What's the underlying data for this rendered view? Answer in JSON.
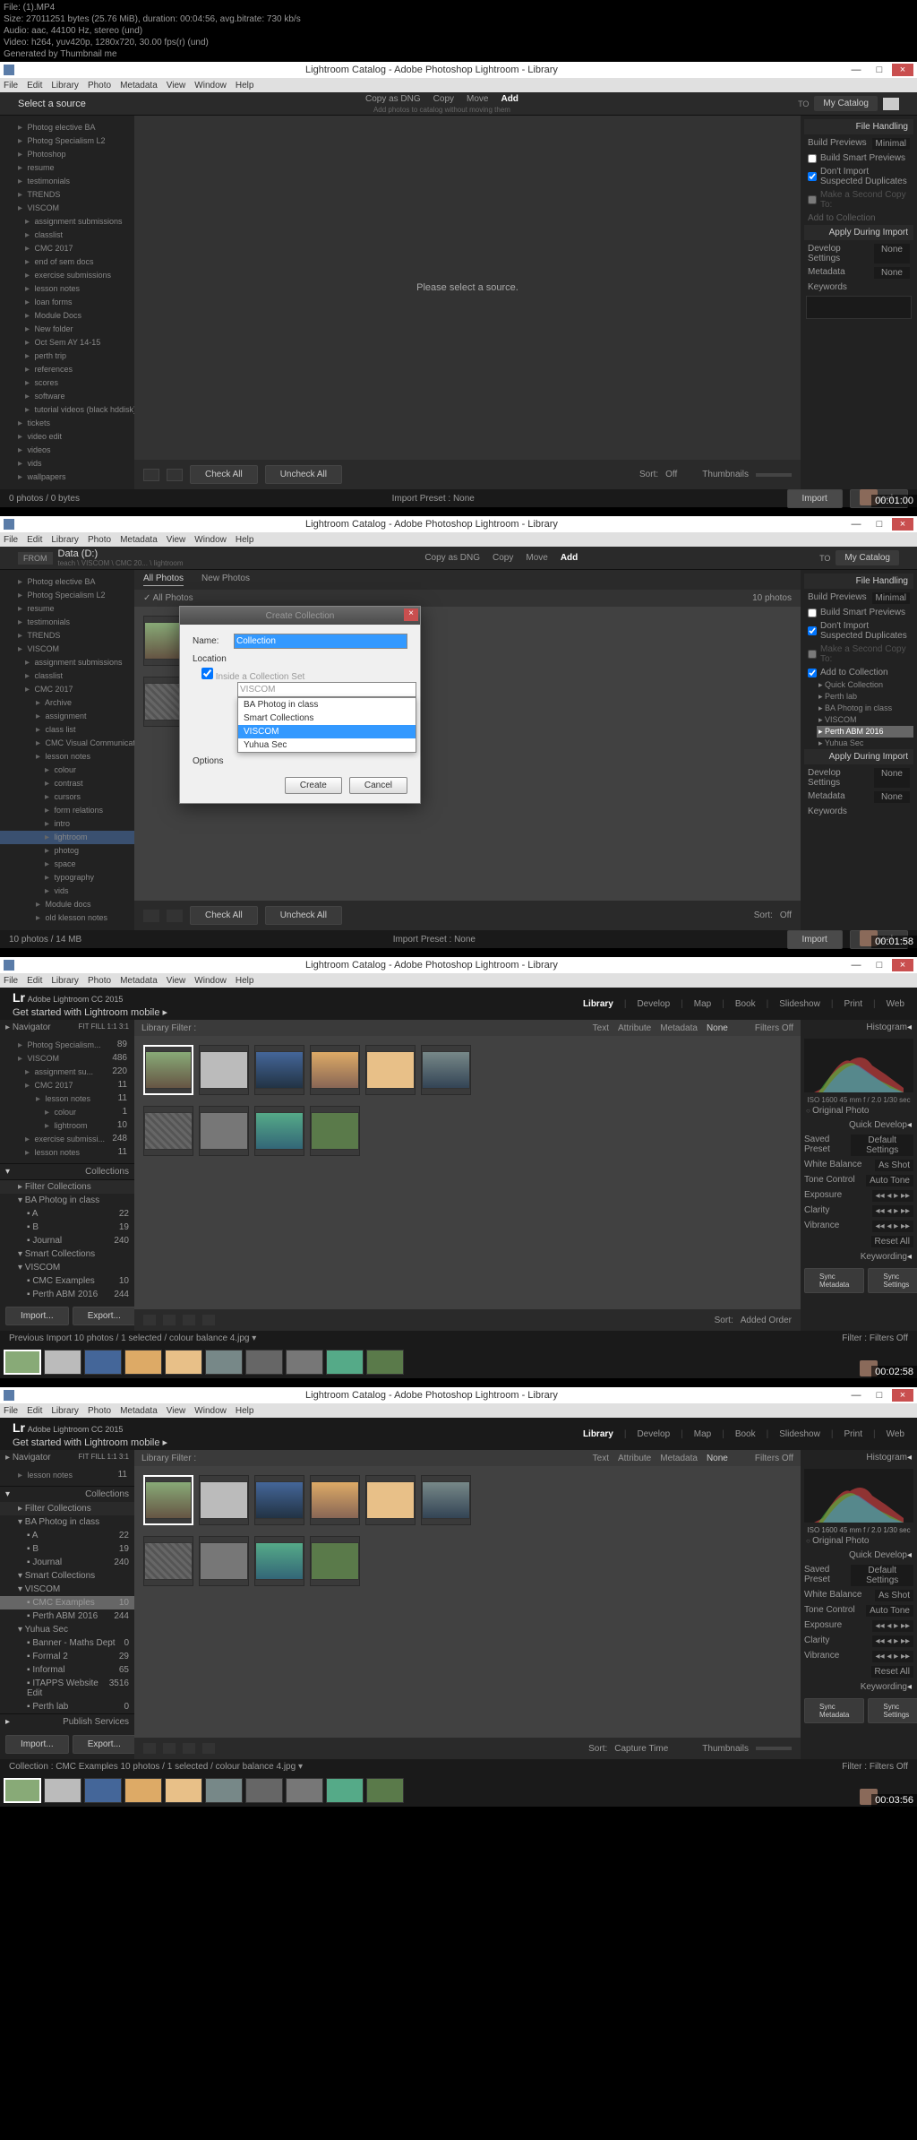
{
  "file_info": {
    "line1": "File:  (1).MP4",
    "line2": "Size: 27011251 bytes (25.76 MiB), duration: 00:04:56, avg.bitrate: 730 kb/s",
    "line3": "Audio: aac, 44100 Hz, stereo (und)",
    "line4": "Video: h264, yuv420p, 1280x720, 30.00 fps(r) (und)",
    "line5": "Generated by Thumbnail me"
  },
  "window_title": "Lightroom Catalog - Adobe Photoshop Lightroom - Library",
  "menu": [
    "File",
    "Edit",
    "Library",
    "Photo",
    "Metadata",
    "View",
    "Window",
    "Help"
  ],
  "s1": {
    "source_label": "Select a source",
    "actions": [
      "Copy as DNG",
      "Copy",
      "Move",
      "Add"
    ],
    "action_sub": "Add photos to catalog without moving them",
    "catalog": "My Catalog",
    "to": "TO",
    "center_msg": "Please select a source.",
    "tree": [
      {
        "l": 0,
        "t": "Photog elective BA"
      },
      {
        "l": 0,
        "t": "Photog Specialism L2"
      },
      {
        "l": 0,
        "t": "Photoshop"
      },
      {
        "l": 0,
        "t": "resume"
      },
      {
        "l": 0,
        "t": "testimonials"
      },
      {
        "l": 0,
        "t": "TRENDS"
      },
      {
        "l": 0,
        "t": "VISCOM"
      },
      {
        "l": 1,
        "t": "assignment submissions"
      },
      {
        "l": 1,
        "t": "classlist"
      },
      {
        "l": 1,
        "t": "CMC 2017"
      },
      {
        "l": 1,
        "t": "end of sem docs"
      },
      {
        "l": 1,
        "t": "exercise submissions"
      },
      {
        "l": 1,
        "t": "lesson notes"
      },
      {
        "l": 1,
        "t": "loan forms"
      },
      {
        "l": 1,
        "t": "Module Docs"
      },
      {
        "l": 1,
        "t": "New folder"
      },
      {
        "l": 1,
        "t": "Oct Sem AY 14-15"
      },
      {
        "l": 1,
        "t": "perth trip"
      },
      {
        "l": 1,
        "t": "references"
      },
      {
        "l": 1,
        "t": "scores"
      },
      {
        "l": 1,
        "t": "software"
      },
      {
        "l": 1,
        "t": "tutorial videos (black hddisk)"
      },
      {
        "l": 0,
        "t": "tickets"
      },
      {
        "l": 0,
        "t": "video edit"
      },
      {
        "l": 0,
        "t": "videos"
      },
      {
        "l": 0,
        "t": "vids"
      },
      {
        "l": 0,
        "t": "wallpapers"
      }
    ],
    "right": {
      "file_handling": "File Handling",
      "build_previews": "Build Previews",
      "minimal": "Minimal",
      "smart_previews": "Build Smart Previews",
      "dont_import": "Don't Import Suspected Duplicates",
      "make_copy": "Make a Second Copy To:",
      "add_collection": "Add to Collection",
      "apply_import": "Apply During Import",
      "develop_settings": "Develop Settings",
      "none": "None",
      "metadata": "Metadata",
      "keywords": "Keywords"
    },
    "buttons": {
      "check_all": "Check All",
      "uncheck_all": "Uncheck All",
      "import": "Import",
      "cancel": "Cancel",
      "import_preset": "Import Preset :",
      "none": "None"
    },
    "sort": "Sort:",
    "off": "Off",
    "thumbnails": "Thumbnails",
    "photos_info": "0 photos / 0 bytes",
    "timestamp": "00:01:00"
  },
  "s2": {
    "from": "FROM",
    "data_d": "Data (D:)",
    "breadcrumb": "teach \\ VISCOM \\ CMC 20... \\ lightroom",
    "all_photos": "All Photos",
    "new_photos": "New Photos",
    "photos_count": "10 photos",
    "dialog": {
      "title": "Create Collection",
      "name_label": "Name:",
      "name_value": "Collection",
      "location": "Location",
      "inside": "Inside a Collection Set",
      "viscom": "VISCOM",
      "options_label": "Options",
      "dropdown": [
        "BA Photog in class",
        "Smart Collections",
        "VISCOM",
        "Yuhua Sec"
      ],
      "create": "Create",
      "cancel": "Cancel"
    },
    "tree": [
      {
        "l": 0,
        "t": "Photog elective BA"
      },
      {
        "l": 0,
        "t": "Photog Specialism L2"
      },
      {
        "l": 0,
        "t": "resume"
      },
      {
        "l": 0,
        "t": "testimonials"
      },
      {
        "l": 0,
        "t": "TRENDS"
      },
      {
        "l": 0,
        "t": "VISCOM"
      },
      {
        "l": 1,
        "t": "assignment submissions"
      },
      {
        "l": 1,
        "t": "classlist"
      },
      {
        "l": 1,
        "t": "CMC 2017"
      },
      {
        "l": 2,
        "t": "Archive"
      },
      {
        "l": 2,
        "t": "assignment"
      },
      {
        "l": 2,
        "t": "class list"
      },
      {
        "l": 2,
        "t": "CMC Visual Communication..."
      },
      {
        "l": 2,
        "t": "lesson notes"
      },
      {
        "l": 3,
        "t": "colour"
      },
      {
        "l": 3,
        "t": "contrast"
      },
      {
        "l": 3,
        "t": "cursors"
      },
      {
        "l": 3,
        "t": "form relations"
      },
      {
        "l": 3,
        "t": "intro"
      },
      {
        "l": 3,
        "t": "lightroom",
        "sel": true
      },
      {
        "l": 3,
        "t": "photog"
      },
      {
        "l": 3,
        "t": "space"
      },
      {
        "l": 3,
        "t": "typography"
      },
      {
        "l": 3,
        "t": "vids"
      },
      {
        "l": 2,
        "t": "Module docs"
      },
      {
        "l": 2,
        "t": "old klesson notes"
      }
    ],
    "right_coll": {
      "add": "Add to Collection",
      "items": [
        "Quick Collection",
        "Perth lab",
        "BA Photog in class",
        "VISCOM",
        "Perth ABM 2016",
        "Yuhua Sec"
      ]
    },
    "photos_info": "10 photos / 14 MB",
    "timestamp": "00:01:58"
  },
  "s3": {
    "lr_cc": "Adobe Lightroom CC 2015",
    "get_started": "Get started with Lightroom mobile  ▸",
    "modules": [
      "Library",
      "Develop",
      "Map",
      "Book",
      "Slideshow",
      "Print",
      "Web"
    ],
    "navigator": "Navigator",
    "nav_opts": "FIT  FILL  1:1  3:1",
    "library_filter": "Library Filter :",
    "filter_opts": [
      "Text",
      "Attribute",
      "Metadata",
      "None"
    ],
    "filters_off": "Filters Off",
    "histogram": "Histogram",
    "histo_info": "ISO 1600    45 mm    f / 2.0    1/30 sec",
    "original": "Original Photo",
    "quick_develop": "Quick Develop",
    "qd": {
      "saved_preset": "Saved Preset",
      "default_settings": "Default Settings",
      "white_balance": "White Balance",
      "as_shot": "As Shot",
      "tone_control": "Tone Control",
      "auto_tone": "Auto Tone",
      "exposure": "Exposure",
      "clarity": "Clarity",
      "vibrance": "Vibrance",
      "reset_all": "Reset All"
    },
    "keywording": "Keywording",
    "sync_meta": "Sync Metadata",
    "sync_settings": "Sync Settings",
    "collections_header": "Collections",
    "filter_collections": "Filter Collections",
    "collections": [
      {
        "l": 0,
        "t": "BA Photog in class",
        "n": ""
      },
      {
        "l": 1,
        "t": "A",
        "n": "22"
      },
      {
        "l": 1,
        "t": "B",
        "n": "19"
      },
      {
        "l": 1,
        "t": "Journal",
        "n": "240"
      },
      {
        "l": 0,
        "t": "Smart Collections",
        "n": ""
      },
      {
        "l": 0,
        "t": "VISCOM",
        "n": ""
      },
      {
        "l": 1,
        "t": "CMC Examples",
        "n": "10"
      },
      {
        "l": 1,
        "t": "Perth ABM 2016",
        "n": "244"
      }
    ],
    "tree": [
      {
        "l": 0,
        "t": "Photog Specialism...",
        "n": "89"
      },
      {
        "l": 0,
        "t": "VISCOM",
        "n": "486"
      },
      {
        "l": 1,
        "t": "assignment su...",
        "n": "220"
      },
      {
        "l": 1,
        "t": "CMC 2017",
        "n": "11"
      },
      {
        "l": 2,
        "t": "lesson notes",
        "n": "11"
      },
      {
        "l": 3,
        "t": "colour",
        "n": "1"
      },
      {
        "l": 3,
        "t": "lightroom",
        "n": "10"
      },
      {
        "l": 1,
        "t": "exercise submissi...",
        "n": "248"
      },
      {
        "l": 1,
        "t": "lesson notes",
        "n": "11"
      }
    ],
    "import": "Import...",
    "export": "Export...",
    "sort_label": "Sort:",
    "sort_val": "Added Order",
    "status": "Previous Import     10 photos / 1 selected / colour balance 4.jpg ▾",
    "filter": "Filter :",
    "timestamp": "00:02:58"
  },
  "s4": {
    "tree": [
      {
        "l": 0,
        "t": "lesson notes",
        "n": "11"
      }
    ],
    "collections": [
      {
        "l": 0,
        "t": "BA Photog in class",
        "n": ""
      },
      {
        "l": 1,
        "t": "A",
        "n": "22"
      },
      {
        "l": 1,
        "t": "B",
        "n": "19"
      },
      {
        "l": 1,
        "t": "Journal",
        "n": "240"
      },
      {
        "l": 0,
        "t": "Smart Collections",
        "n": ""
      },
      {
        "l": 0,
        "t": "VISCOM",
        "n": ""
      },
      {
        "l": 1,
        "t": "CMC Examples",
        "n": "10",
        "sel": true
      },
      {
        "l": 1,
        "t": "Perth ABM 2016",
        "n": "244"
      },
      {
        "l": 0,
        "t": "Yuhua Sec",
        "n": ""
      },
      {
        "l": 1,
        "t": "Banner - Maths Dept",
        "n": "0"
      },
      {
        "l": 1,
        "t": "Formal 2",
        "n": "29"
      },
      {
        "l": 1,
        "t": "Informal",
        "n": "65"
      },
      {
        "l": 1,
        "t": "ITAPPS Website Edit",
        "n": "3516"
      },
      {
        "l": 1,
        "t": "Perth lab",
        "n": "0"
      }
    ],
    "publish": "Publish Services",
    "sort_val": "Capture Time",
    "status": "Collection : CMC Examples     10 photos / 1 selected / colour balance 4.jpg ▾",
    "thumbnails": "Thumbnails",
    "timestamp": "00:03:56"
  }
}
